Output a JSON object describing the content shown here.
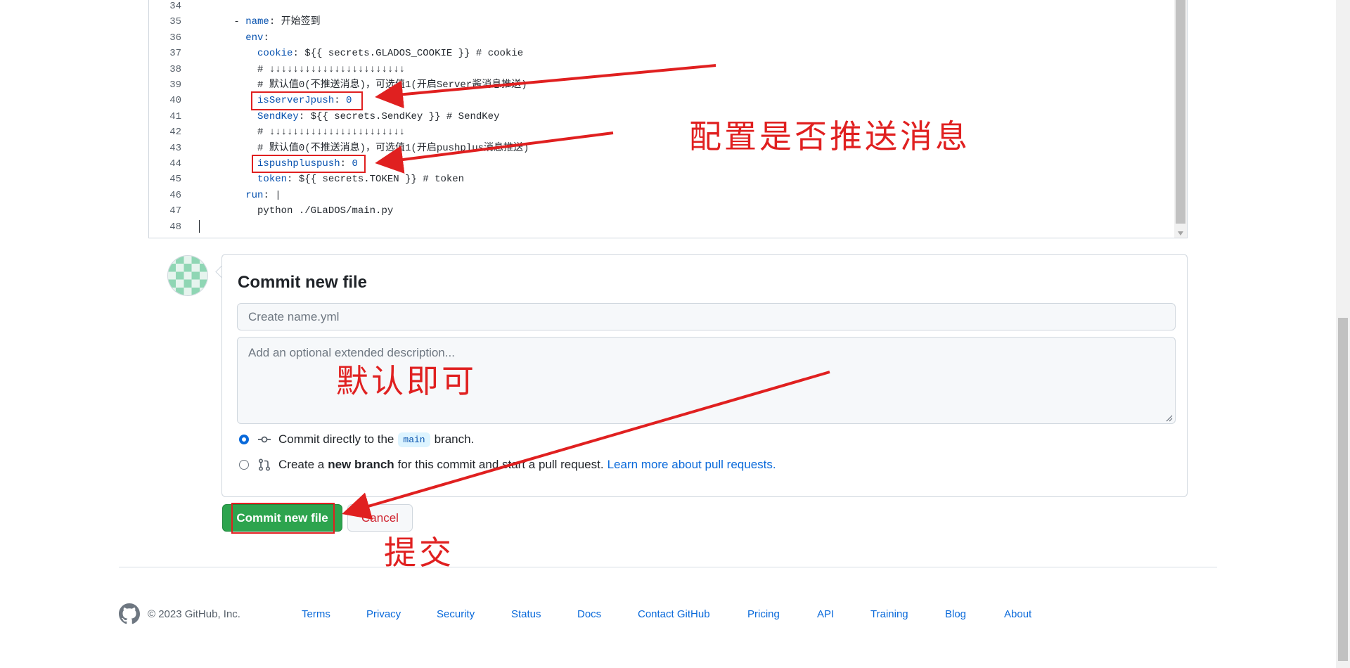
{
  "editor": {
    "lines": [
      {
        "num": "34",
        "indent": "",
        "key": "",
        "sep": "",
        "rest": ""
      },
      {
        "num": "35",
        "indent": "      - ",
        "key": "name",
        "sep": ": ",
        "rest": "开始签到"
      },
      {
        "num": "36",
        "indent": "        ",
        "key": "env",
        "sep": ":",
        "rest": ""
      },
      {
        "num": "37",
        "indent": "          ",
        "key": "cookie",
        "sep": ": ",
        "rest": "${{ secrets.GLADOS_COOKIE }} # cookie"
      },
      {
        "num": "38",
        "indent": "          ",
        "key": "",
        "sep": "",
        "rest": "# ↓↓↓↓↓↓↓↓↓↓↓↓↓↓↓↓↓↓↓↓↓↓↓"
      },
      {
        "num": "39",
        "indent": "          ",
        "key": "",
        "sep": "",
        "rest": "# 默认值0(不推送消息)，可选值1(开启Server酱消息推送)"
      },
      {
        "num": "40",
        "indent": "          ",
        "key": "isServerJpush",
        "sep": ": ",
        "rest": "0"
      },
      {
        "num": "41",
        "indent": "          ",
        "key": "SendKey",
        "sep": ": ",
        "rest": "${{ secrets.SendKey }} # SendKey"
      },
      {
        "num": "42",
        "indent": "          ",
        "key": "",
        "sep": "",
        "rest": "# ↓↓↓↓↓↓↓↓↓↓↓↓↓↓↓↓↓↓↓↓↓↓↓"
      },
      {
        "num": "43",
        "indent": "          ",
        "key": "",
        "sep": "",
        "rest": "# 默认值0(不推送消息)，可选值1(开启pushplus消息推送)"
      },
      {
        "num": "44",
        "indent": "          ",
        "key": "ispushpluspush",
        "sep": ": ",
        "rest": "0"
      },
      {
        "num": "45",
        "indent": "          ",
        "key": "token",
        "sep": ": ",
        "rest": "${{ secrets.TOKEN }} # token"
      },
      {
        "num": "46",
        "indent": "        ",
        "key": "run",
        "sep": ": ",
        "rest": "|"
      },
      {
        "num": "47",
        "indent": "          ",
        "key": "",
        "sep": "",
        "rest": "python ./GLaDOS/main.py"
      },
      {
        "num": "48",
        "indent": "",
        "key": "",
        "sep": "",
        "rest": ""
      }
    ]
  },
  "commit": {
    "title": "Commit new file",
    "summary_placeholder": "Create name.yml",
    "description_placeholder": "Add an optional extended description...",
    "option_direct": {
      "prefix": "Commit directly to the",
      "branch": "main",
      "suffix": "branch."
    },
    "option_new": {
      "prefix": "Create a",
      "bold": "new branch",
      "suffix": "for this commit and start a pull request.",
      "link": "Learn more about pull requests."
    },
    "commit_button": "Commit new file",
    "cancel_button": "Cancel"
  },
  "footer": {
    "copyright": "© 2023 GitHub, Inc.",
    "links": [
      "Terms",
      "Privacy",
      "Security",
      "Status",
      "Docs",
      "Contact GitHub",
      "Pricing",
      "API",
      "Training",
      "Blog",
      "About"
    ]
  },
  "annotations": {
    "configure_push": "配置是否推送消息",
    "default_ok": "默认即可",
    "submit": "提交"
  },
  "colors": {
    "annotation": "#e02020",
    "commit_green": "#2da44e",
    "link_blue": "#0969da"
  }
}
